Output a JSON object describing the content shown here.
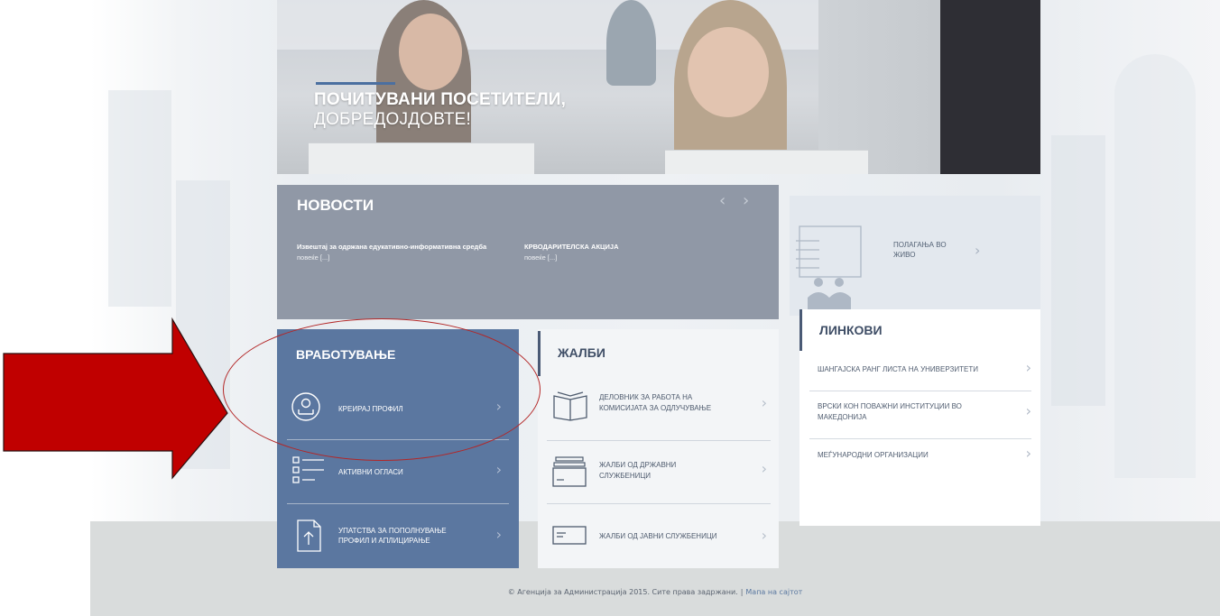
{
  "hero": {
    "title_line1": "ПОЧИТУВАНИ ПОСЕТИТЕЛИ,",
    "title_line2": "ДОБРЕДОЈДОВТЕ!"
  },
  "news": {
    "title": "НОВОСТИ",
    "prev_icon": "chevron-left-icon",
    "next_icon": "chevron-right-icon",
    "items": [
      {
        "title": "Извештај за одржана едукативно-информативна средба",
        "more": "повеќе [...]"
      },
      {
        "title": "КРВОДАРИТЕЛСКА АКЦИЈА",
        "more": "повеќе [...]"
      }
    ]
  },
  "employment": {
    "title": "ВРАБОТУВАЊЕ",
    "items": [
      {
        "label": "КРЕИРАЈ ПРОФИЛ",
        "icon": "user-profile-icon"
      },
      {
        "label": "АКТИВНИ ОГЛАСИ",
        "icon": "list-icon"
      },
      {
        "label_line1": "УПАТСТВА ЗА ПОПОЛНУВАЊЕ",
        "label_line2": "ПРОФИЛ И АПЛИЦИРАЊЕ",
        "icon": "document-upload-icon"
      }
    ]
  },
  "complaints": {
    "title": "ЖАЛБИ",
    "items": [
      {
        "label_line1": "ДЕЛОВНИК ЗА РАБОТА НА",
        "label_line2": "КОМИСИЈАТА ЗА ОДЛУЧУВАЊЕ",
        "icon": "book-icon"
      },
      {
        "label_line1": "ЖАЛБИ ОД ДРЖАВНИ",
        "label_line2": "СЛУЖБЕНИЦИ",
        "icon": "card-stack-icon"
      },
      {
        "label": "ЖАЛБИ ОД ЈАВНИ СЛУЖБЕНИЦИ",
        "icon": "card-icon"
      }
    ]
  },
  "live_exams": {
    "label_line1": "ПОЛАГАЊА ВО",
    "label_line2": "ЖИВО",
    "icon": "presentation-board-icon"
  },
  "links": {
    "title": "ЛИНКОВИ",
    "items": [
      {
        "label": "ШАНГАЈСКА РАНГ ЛИСТА НА УНИВЕРЗИТЕТИ"
      },
      {
        "label_line1": "ВРСКИ КОН ПОВАЖНИ ИНСТИТУЦИИ ВО",
        "label_line2": "МАКЕДОНИЈА"
      },
      {
        "label": "МЕЃУНАРОДНИ ОРГАНИЗАЦИИ"
      }
    ]
  },
  "footer": {
    "copyright": "© Агенција за Администрација 2015. Сите права задржани.",
    "separator": "|",
    "sitemap": "Мапа на сајтот"
  },
  "colors": {
    "employment_bg": "#5b77a0",
    "news_bg": "#9098a6",
    "annotation_red": "#c00000"
  }
}
